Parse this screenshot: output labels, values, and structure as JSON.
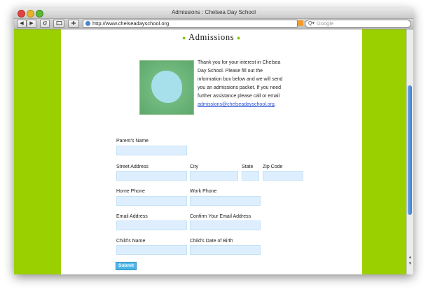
{
  "window": {
    "title": "Admissions : Chelsea Day School"
  },
  "toolbar": {
    "back": "◀",
    "forward": "▶",
    "reload": "C",
    "addr_url": "http://www.chelseadayschool.org",
    "search_placeholder": "Google",
    "search_glyph": "Q▾"
  },
  "page": {
    "heading": "Admissions",
    "intro": "Thank you for your interest in Chelsea Day School. Please fill out the information box below and we will send you an admissions packet. If you need further assistance please call or email ",
    "email_link": "admissions@chelseadayschool.org",
    "intro_end": "."
  },
  "form": {
    "parents_name": "Parent's Name",
    "street_address": "Street Address",
    "city": "City",
    "state": "State",
    "zip": "Zip Code",
    "home_phone": "Home Phone",
    "work_phone": "Work Phone",
    "email": "Email Address",
    "confirm_email": "Confirm Your Email Address",
    "childs_name": "Child's Name",
    "childs_dob": "Child's Date of Birth",
    "submit": "Submit"
  },
  "colors": {
    "accent_green": "#9bd000",
    "field_bg": "#ddefff",
    "submit": "#4cb6e8",
    "link": "#2a52d6"
  }
}
